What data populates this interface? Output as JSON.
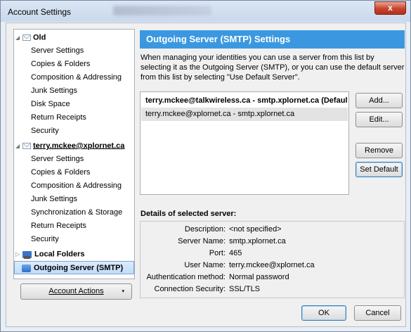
{
  "window": {
    "title": "Account Settings",
    "close_glyph": "x"
  },
  "tree": {
    "account1": {
      "name": "Old",
      "items": [
        "Server Settings",
        "Copies & Folders",
        "Composition & Addressing",
        "Junk Settings",
        "Disk Space",
        "Return Receipts",
        "Security"
      ]
    },
    "account2": {
      "name": "terry.mckee@xplornet.ca",
      "items": [
        "Server Settings",
        "Copies & Folders",
        "Composition & Addressing",
        "Junk Settings",
        "Synchronization & Storage",
        "Return Receipts",
        "Security"
      ]
    },
    "local_folders": "Local Folders",
    "outgoing": "Outgoing Server (SMTP)"
  },
  "account_actions": {
    "label": "Account Actions",
    "caret": "▾"
  },
  "smtp": {
    "heading": "Outgoing Server (SMTP) Settings",
    "description": "When managing your identities you can use a server from this list by selecting it as the Outgoing Server (SMTP), or you can use the default server from this list by selecting \"Use Default Server\".",
    "servers": [
      "terry.mckee@talkwireless.ca - smtp.xplornet.ca (Default)",
      "terry.mckee@xplornet.ca - smtp.xplornet.ca"
    ],
    "buttons": {
      "add": "Add...",
      "edit": "Edit...",
      "remove": "Remove",
      "set_default": "Set Default"
    },
    "details_label": "Details of selected server:",
    "details": [
      {
        "key": "Description:",
        "value": "<not specified>"
      },
      {
        "key": "Server Name:",
        "value": "smtp.xplornet.ca"
      },
      {
        "key": "Port:",
        "value": "465"
      },
      {
        "key": "User Name:",
        "value": "terry.mckee@xplornet.ca"
      },
      {
        "key": "Authentication method:",
        "value": "Normal password"
      },
      {
        "key": "Connection Security:",
        "value": "SSL/TLS"
      }
    ]
  },
  "footer": {
    "ok": "OK",
    "cancel": "Cancel"
  }
}
